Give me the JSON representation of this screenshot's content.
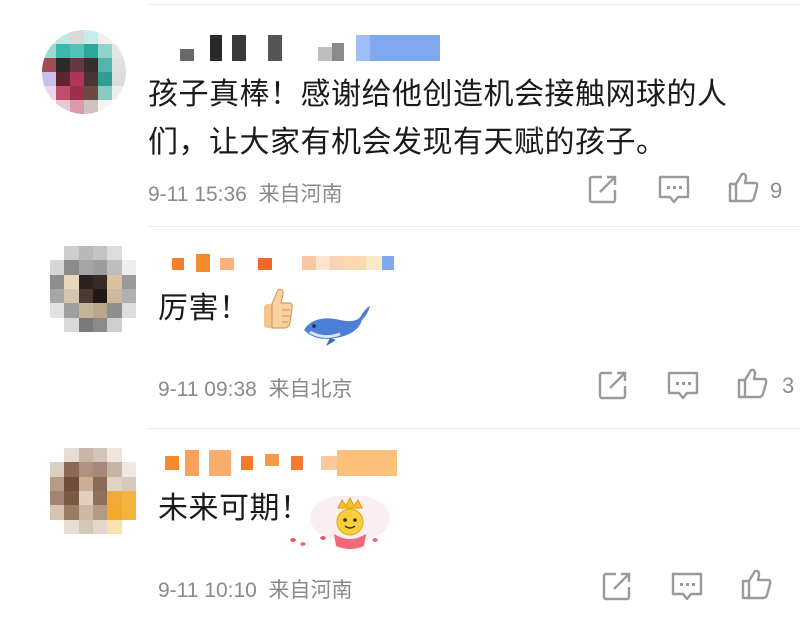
{
  "comments": [
    {
      "text_lines": [
        "孩子真棒！感谢给他创造机会接触网球的人",
        "们，让大家有机会发现有天赋的孩子。"
      ],
      "date": "9-11 15:36",
      "location": "来自河南",
      "like_count": "9",
      "icons": {
        "share": "share-icon",
        "comment": "comment-icon",
        "like": "thumbs-up-icon"
      }
    },
    {
      "text": "厉害！",
      "emoji": "thumbs-up-emoji",
      "date": "9-11 09:38",
      "location": "来自北京",
      "like_count": "3",
      "icons": {
        "share": "share-icon",
        "comment": "comment-icon",
        "like": "thumbs-up-icon"
      }
    },
    {
      "text": "未来可期！",
      "emoji": "crown-face-emoji",
      "date": "9-11 10:10",
      "location": "来自河南",
      "like_count": "",
      "icons": {
        "share": "share-icon",
        "comment": "comment-icon",
        "like": "thumbs-up-icon"
      }
    }
  ],
  "colors": {
    "text": "#1a1a1a",
    "meta": "#8a8a8a",
    "icon": "#9a9a9a",
    "username_orange": "#f58a2e",
    "username_blue": "#7fa8f0"
  }
}
